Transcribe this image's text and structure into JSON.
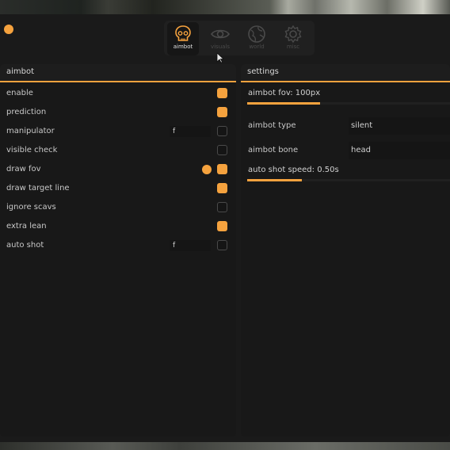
{
  "accent_color": "#f5a23e",
  "tabs": [
    {
      "label": "aimbot",
      "icon": "skull-icon",
      "active": true
    },
    {
      "label": "visuals",
      "icon": "eye-icon",
      "active": false
    },
    {
      "label": "world",
      "icon": "globe-icon",
      "active": false
    },
    {
      "label": "misc",
      "icon": "gear-icon",
      "active": false
    }
  ],
  "left_panel": {
    "title": "aimbot",
    "rows": [
      {
        "label": "enable",
        "checked": true
      },
      {
        "label": "prediction",
        "checked": true
      },
      {
        "label": "manipulator",
        "keybind": "f",
        "checked": false
      },
      {
        "label": "visible check",
        "checked": false
      },
      {
        "label": "draw fov",
        "checked": true,
        "color": "#f5a23e"
      },
      {
        "label": "draw target line",
        "checked": true
      },
      {
        "label": "ignore scavs",
        "checked": false
      },
      {
        "label": "extra lean",
        "checked": true
      },
      {
        "label": "auto shot",
        "keybind": "f",
        "checked": false
      }
    ]
  },
  "right_panel": {
    "title": "settings",
    "fov_slider": {
      "label": "aimbot fov: 100px",
      "fill_fraction": 0.36
    },
    "aimbot_type": {
      "label": "aimbot type",
      "value": "silent"
    },
    "aimbot_bone": {
      "label": "aimbot bone",
      "value": "head"
    },
    "autoshot_slider": {
      "label": "auto shot speed: 0.50s",
      "fill_fraction": 0.27
    }
  }
}
